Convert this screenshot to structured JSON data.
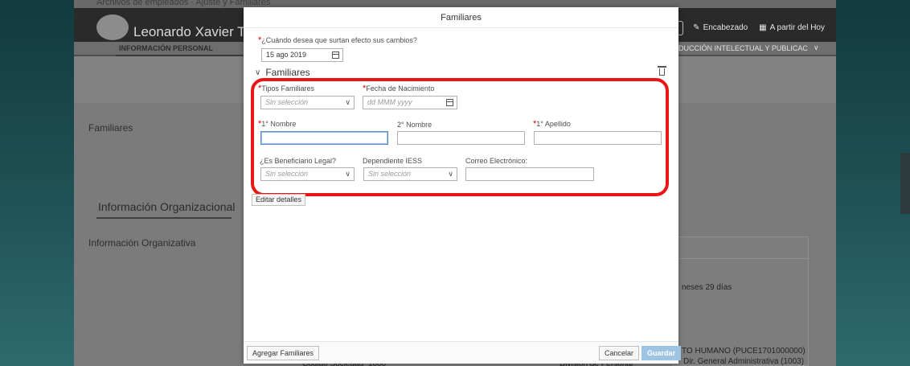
{
  "background": {
    "top_text": "Archivos de empleados  ·  Ajuste y Familiares",
    "employee_name": "Leonardo Xavier Ta",
    "header_actions": [
      {
        "label": "Encabezado"
      },
      {
        "label": "A partir del Hoy"
      }
    ],
    "nav_left": "INFORMACIÓN PERSONAL",
    "nav_right": "DUCCIÓN INTELECTUAL Y PUBLICAC",
    "section_familiares": "Familiares",
    "section_org": "Información Organizacional",
    "section_org_info": "Información Organizativa",
    "card_texts": {
      "months": "neses 29 días",
      "talento": "TO HUMANO (PUCE1701000000)",
      "division": "Dir. General Administrativa (1003)",
      "codigo_label": "Código Sociedad",
      "codigo_value": "1000",
      "division_label": "División de Personal"
    }
  },
  "dialog": {
    "title": "Familiares",
    "effect_question": "¿Cuándo desea que surtan efecto sus cambios?",
    "effect_date": "15 ago 2019",
    "section_title": "Familiares",
    "fields": {
      "tipos": {
        "label": "Tipos Familiares",
        "placeholder": "Sin selección"
      },
      "fecha_nac": {
        "label": "Fecha de Nacimiento",
        "placeholder": "dd MMM yyyy"
      },
      "nombre1": {
        "label": "1° Nombre",
        "value": ""
      },
      "nombre2": {
        "label": "2° Nombre",
        "value": ""
      },
      "apellido1": {
        "label": "1° Apellido",
        "value": ""
      },
      "beneficiario": {
        "label": "¿Es Beneficiario Legal?",
        "placeholder": "Sin selección"
      },
      "dependiente": {
        "label": "Dependiente IESS",
        "placeholder": "Sin selección"
      },
      "correo": {
        "label": "Correo Electrónico:",
        "value": ""
      }
    },
    "edit_details": "Editar detalles",
    "footer": {
      "add_label": "Agregar Familiares",
      "cancel_label": "Cancelar",
      "save_label": "Guardar"
    }
  },
  "colors": {
    "required": "#e00000",
    "highlight": "#ea1616",
    "primary_button": "#9ec4e4"
  }
}
